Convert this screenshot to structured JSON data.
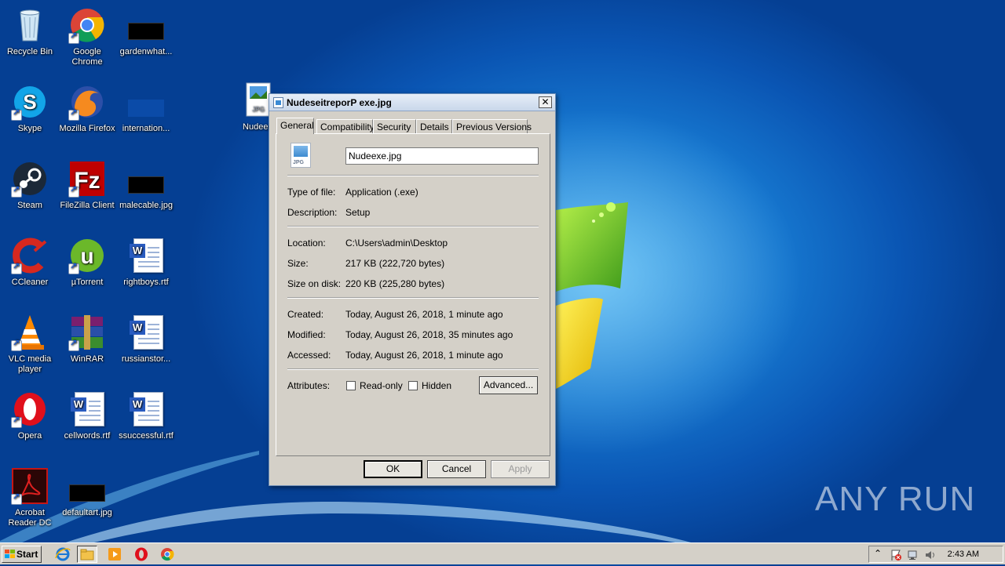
{
  "desktop": {
    "icons": [
      {
        "label": "Recycle Bin"
      },
      {
        "label": "Google Chrome"
      },
      {
        "label": "gardenwhat..."
      },
      {
        "label": "Skype"
      },
      {
        "label": "Mozilla Firefox"
      },
      {
        "label": "internation..."
      },
      {
        "label": "Nudeex"
      },
      {
        "label": "Steam"
      },
      {
        "label": "FileZilla Client"
      },
      {
        "label": "malecable.jpg"
      },
      {
        "label": "CCleaner"
      },
      {
        "label": "µTorrent"
      },
      {
        "label": "rightboys.rtf"
      },
      {
        "label": "VLC media player"
      },
      {
        "label": "WinRAR"
      },
      {
        "label": "russianstor..."
      },
      {
        "label": "Opera"
      },
      {
        "label": "cellwords.rtf"
      },
      {
        "label": "ssuccessful.rtf"
      },
      {
        "label": "Acrobat Reader DC"
      },
      {
        "label": "defaultart.jpg"
      }
    ]
  },
  "dialog": {
    "title": "NudeseitreporP exe.jpg",
    "close_label": "✕",
    "tabs": [
      "General",
      "Compatibility",
      "Security",
      "Details",
      "Previous Versions"
    ],
    "active_tab": "General",
    "file_icon_ext": "JPG",
    "filename": "Nudeexe.jpg",
    "type_of_file_label": "Type of file:",
    "type_of_file": "Application (.exe)",
    "description_label": "Description:",
    "description": "Setup",
    "location_label": "Location:",
    "location": "C:\\Users\\admin\\Desktop",
    "size_label": "Size:",
    "size": "217 KB (222,720 bytes)",
    "size_on_disk_label": "Size on disk:",
    "size_on_disk": "220 KB (225,280 bytes)",
    "created_label": "Created:",
    "created": "Today, August 26, 2018, 1 minute ago",
    "modified_label": "Modified:",
    "modified": "Today, August 26, 2018, 35 minutes ago",
    "accessed_label": "Accessed:",
    "accessed": "Today, August 26, 2018, 1 minute ago",
    "attributes_label": "Attributes:",
    "readonly_label": "Read-only",
    "readonly_checked": false,
    "hidden_label": "Hidden",
    "hidden_checked": false,
    "advanced_label": "Advanced...",
    "ok_label": "OK",
    "cancel_label": "Cancel",
    "apply_label": "Apply"
  },
  "taskbar": {
    "start_label": "Start",
    "clock": "2:43 AM",
    "tray_expand": "⌃"
  },
  "watermark": "ANY RUN"
}
